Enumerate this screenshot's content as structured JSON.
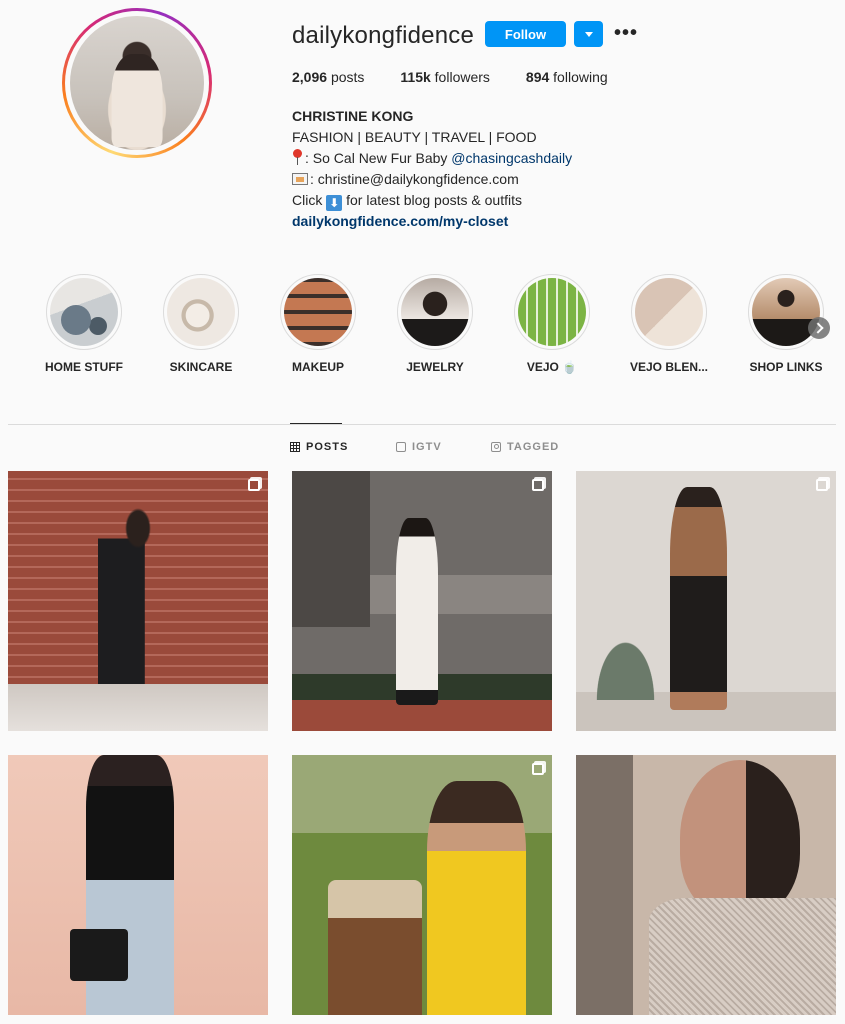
{
  "profile": {
    "username": "dailykongfidence",
    "follow_label": "Follow",
    "more_label": "•••",
    "stats": {
      "posts_count": "2,096",
      "posts_label": "posts",
      "followers_count": "115k",
      "followers_label": "followers",
      "following_count": "894",
      "following_label": "following"
    },
    "bio": {
      "name": "CHRISTINE KONG",
      "line1": "FASHION | BEAUTY | TRAVEL | FOOD",
      "line2_text": ": So Cal New Fur Baby ",
      "line2_mention": "@chasingcashdaily",
      "line3_text": ": christine@dailykongfidence.com",
      "line4_pre": "Click ",
      "line4_icon": "⬇",
      "line4_post": " for latest blog posts & outfits",
      "link": "dailykongfidence.com/my-closet"
    }
  },
  "highlights": [
    {
      "label": "HOME STUFF"
    },
    {
      "label": "SKINCARE"
    },
    {
      "label": "MAKEUP"
    },
    {
      "label": "JEWELRY"
    },
    {
      "label": "VEJO 🍵"
    },
    {
      "label": "VEJO BLEN..."
    },
    {
      "label": "SHOP LINKS"
    }
  ],
  "tabs": [
    {
      "label": "POSTS",
      "active": true
    },
    {
      "label": "IGTV",
      "active": false
    },
    {
      "label": "TAGGED",
      "active": false
    }
  ],
  "colors": {
    "follow_blue": "#0095f6",
    "link_blue": "#00376b",
    "text": "#262626",
    "muted": "#8e8e8e"
  }
}
